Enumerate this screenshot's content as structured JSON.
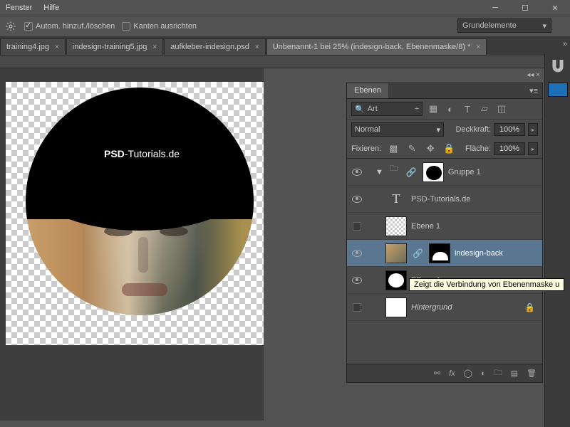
{
  "menu": {
    "fenster": "Fenster",
    "hilfe": "Hilfe"
  },
  "options": {
    "auto_add_delete": "Autom. hinzuf./löschen",
    "align_edges": "Kanten ausrichten"
  },
  "workspace_selector": "Grundelemente",
  "tabs": [
    {
      "label": "training4.jpg",
      "active": false
    },
    {
      "label": "indesign-training5.jpg",
      "active": false
    },
    {
      "label": "aufkleber-indesign.psd",
      "active": false
    },
    {
      "label": "Unbenannt-1 bei 25% (indesign-back, Ebenenmaske/8) *",
      "active": true
    }
  ],
  "canvas": {
    "text_bold": "PSD",
    "text_rest": "-Tutorials.de"
  },
  "panel": {
    "title": "Ebenen",
    "search_label": "Art",
    "blend_mode": "Normal",
    "opacity_label": "Deckkraft:",
    "opacity_value": "100%",
    "fill_label": "Fläche:",
    "fill_value": "100%",
    "lock_label": "Fixieren:"
  },
  "layers": [
    {
      "name": "Gruppe 1",
      "type": "group",
      "vis": true
    },
    {
      "name": "PSD-Tutorials.de",
      "type": "text",
      "vis": true
    },
    {
      "name": "Ebene 1",
      "type": "raster",
      "vis": false
    },
    {
      "name": "indesign-back",
      "type": "masked",
      "vis": true,
      "selected": true
    },
    {
      "name": "Ellipse 1",
      "type": "shape",
      "vis": true
    },
    {
      "name": "Hintergrund",
      "type": "bg",
      "vis": false,
      "italic": true,
      "locked": true
    }
  ],
  "tooltip": "Zeigt die Verbindung von Ebenenmaske u",
  "foot_icons": [
    "link",
    "fx",
    "mask",
    "adjust",
    "group",
    "new",
    "trash"
  ]
}
